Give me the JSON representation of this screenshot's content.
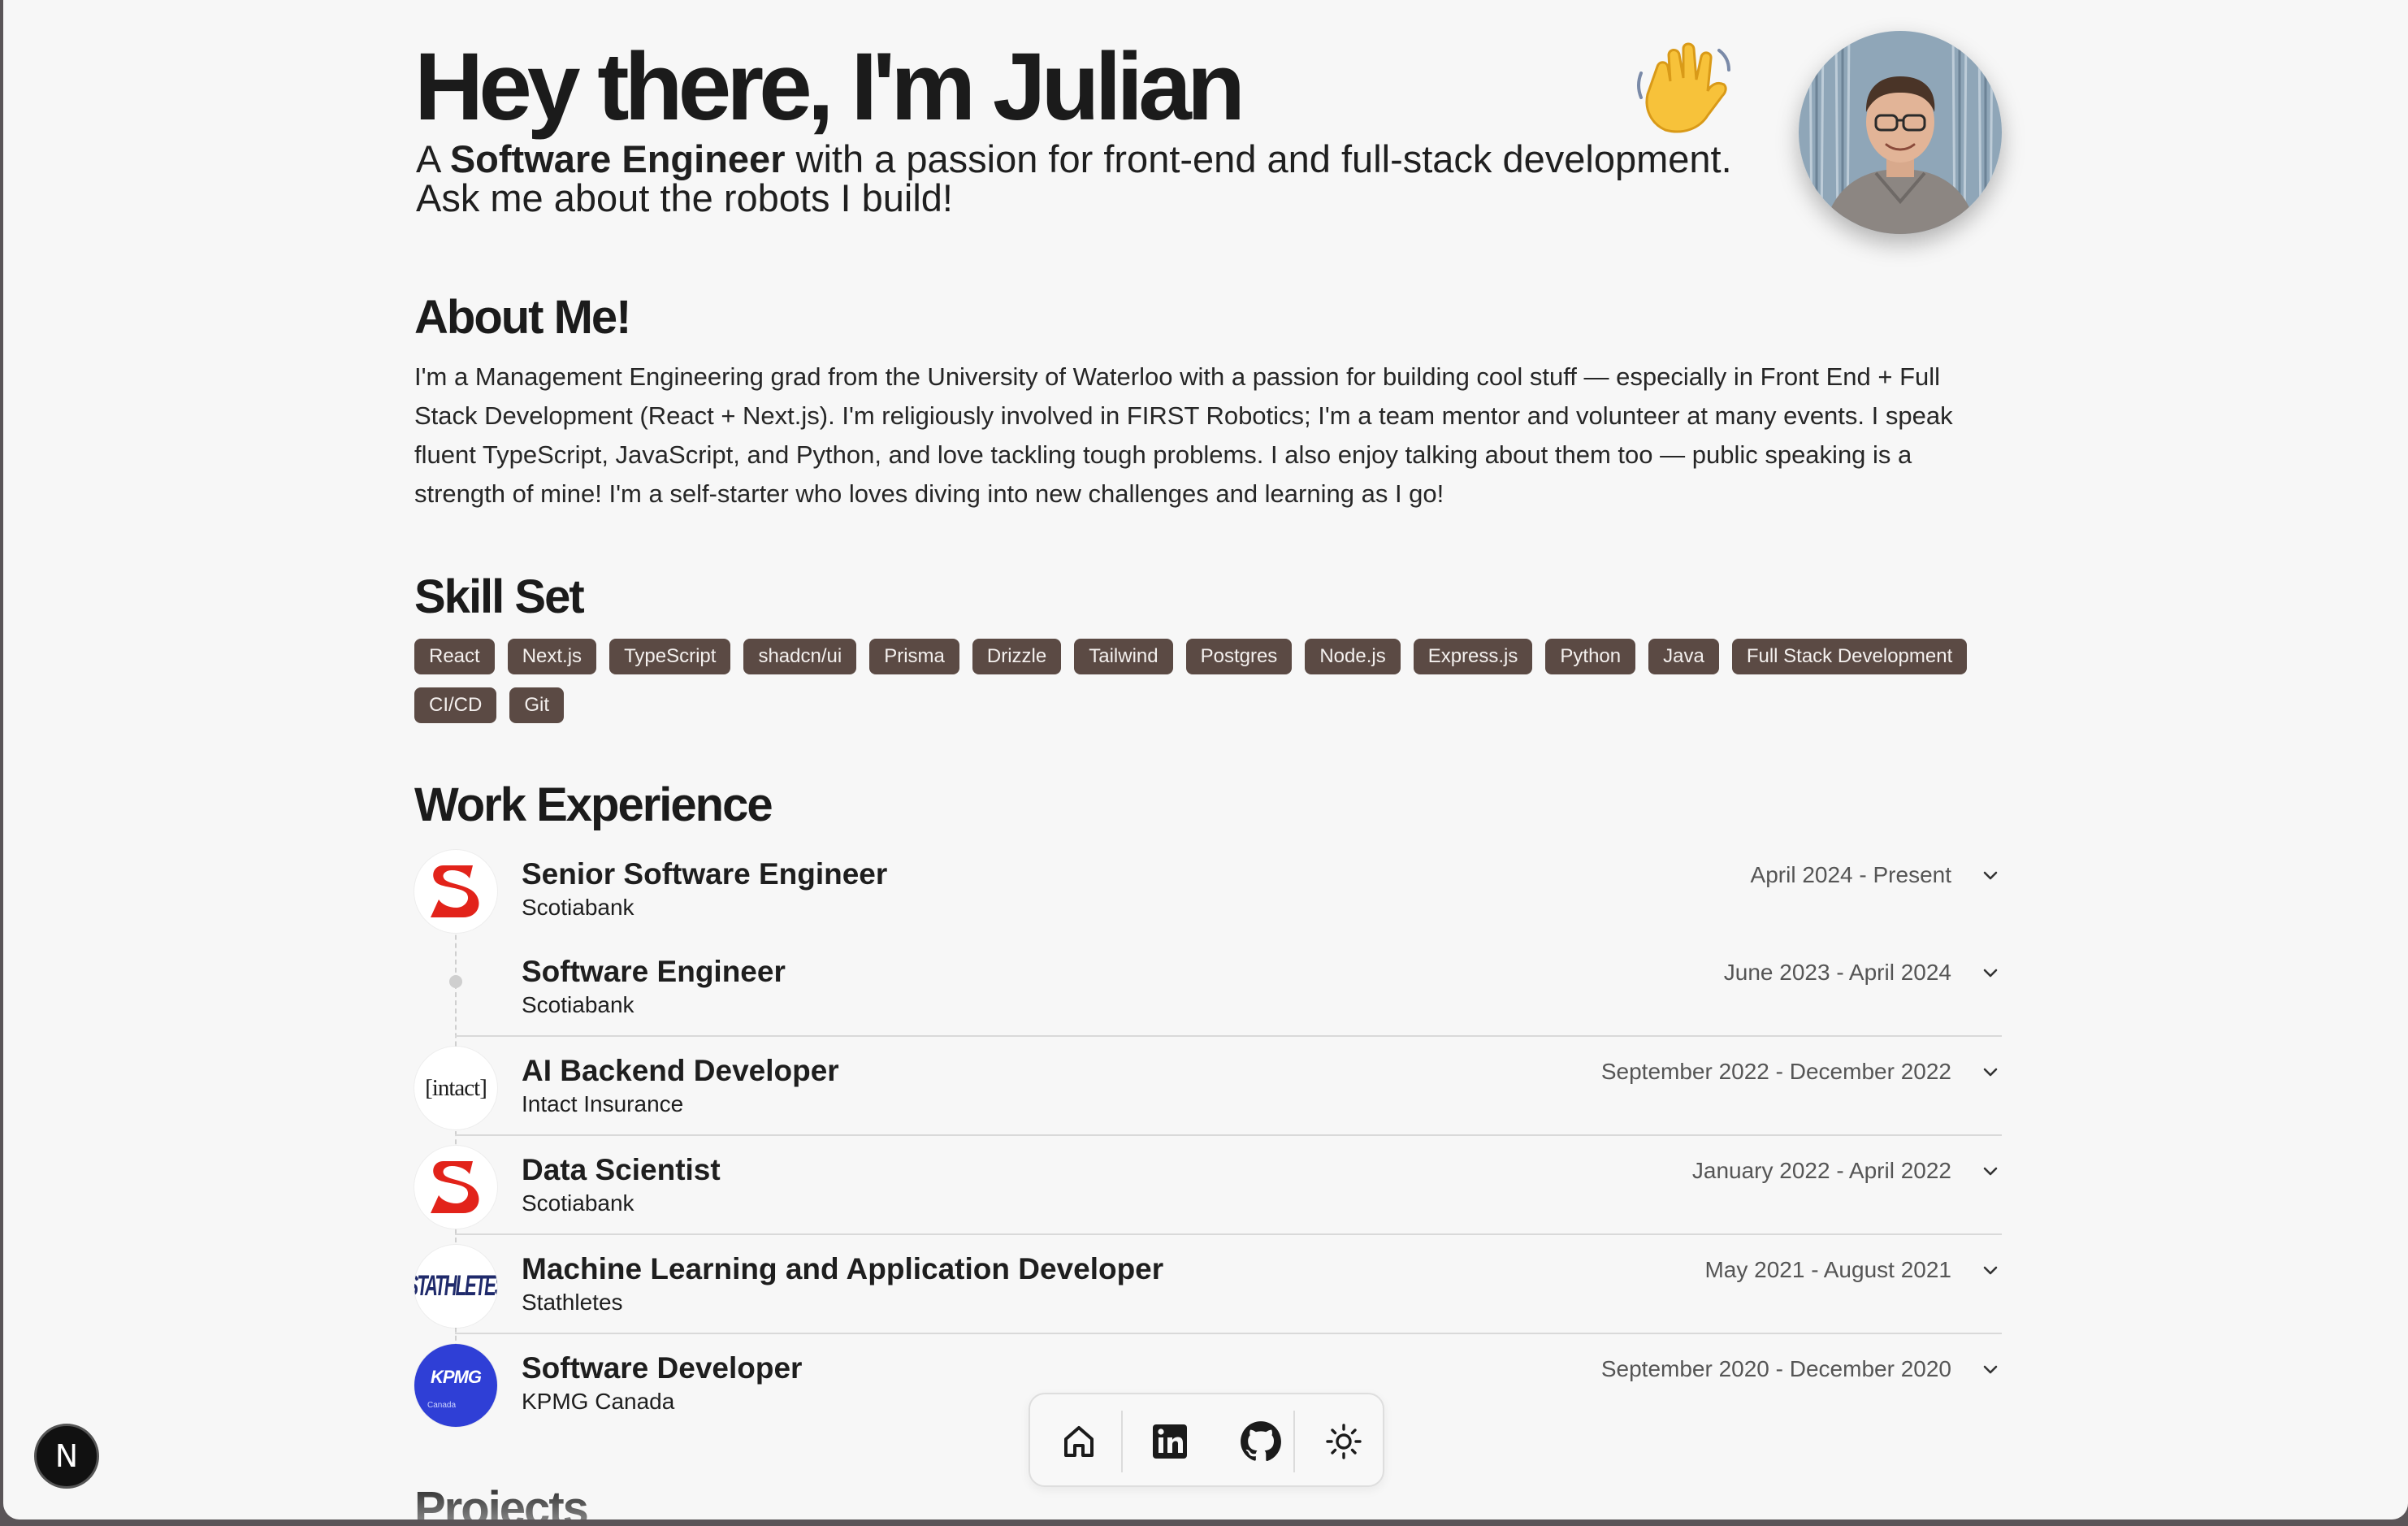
{
  "hero": {
    "title": "Hey there, I'm Julian",
    "wave_emoji": "👋",
    "subtitle_prefix": "A ",
    "subtitle_bold": "Software Engineer",
    "subtitle_rest": " with a passion for front-end and full-stack development.",
    "subtitle_line2": "Ask me about the robots I build!"
  },
  "about": {
    "heading": "About Me!",
    "text": "I'm a Management Engineering grad from the University of Waterloo with a passion for building cool stuff — especially in Front End + Full Stack Development (React + Next.js). I'm religiously involved in FIRST Robotics; I'm a team mentor and volunteer at many events. I speak fluent TypeScript, JavaScript, and Python, and love tackling tough problems. I also enjoy talking about them too — public speaking is a strength of mine! I'm a self-starter who loves diving into new challenges and learning as I go!"
  },
  "skills": {
    "heading": "Skill Set",
    "items": [
      "React",
      "Next.js",
      "TypeScript",
      "shadcn/ui",
      "Prisma",
      "Drizzle",
      "Tailwind",
      "Postgres",
      "Node.js",
      "Express.js",
      "Python",
      "Java",
      "Full Stack Development",
      "CI/CD",
      "Git"
    ]
  },
  "work": {
    "heading": "Work Experience",
    "jobs": [
      {
        "title": "Senior Software Engineer",
        "company": "Scotiabank",
        "dates": "April 2024 - Present",
        "logo": "scotiabank-logo"
      },
      {
        "title": "Software Engineer",
        "company": "Scotiabank",
        "dates": "June 2023 - April 2024",
        "logo": "timeline-dot"
      },
      {
        "title": "AI Backend Developer",
        "company": "Intact Insurance",
        "dates": "September 2022 - December 2022",
        "logo": "intact-logo",
        "logo_text": "[intact]"
      },
      {
        "title": "Data Scientist",
        "company": "Scotiabank",
        "dates": "January 2022 - April 2022",
        "logo": "scotiabank-logo"
      },
      {
        "title": "Machine Learning and Application Developer",
        "company": "Stathletes",
        "dates": "May 2021 - August 2021",
        "logo": "stathletes-logo",
        "logo_text": "STATHLETES"
      },
      {
        "title": "Software Developer",
        "company": "KPMG Canada",
        "dates": "September 2020 - December 2020",
        "logo": "kpmg-logo",
        "logo_text": "KPMG",
        "logo_subtext": "Canada"
      }
    ]
  },
  "projects": {
    "heading": "Projects"
  },
  "dock": {
    "icons": [
      "home-icon",
      "linkedin-icon",
      "github-icon",
      "theme-toggle-icon"
    ]
  },
  "next_badge": {
    "label": "N"
  },
  "colors": {
    "background": "#f7f7f7",
    "skill_badge": "#5b4a44",
    "scotiabank_red": "#e2231a",
    "intact_red": "#b5121b",
    "stathletes_navy": "#1f2a6b",
    "kpmg_blue": "#2f3fd6"
  }
}
